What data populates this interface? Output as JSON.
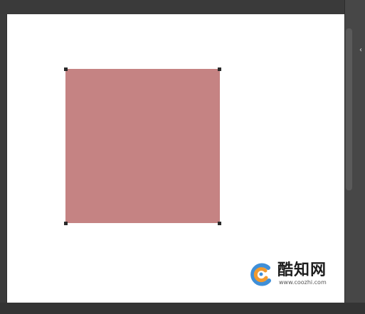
{
  "colors": {
    "shape_fill": "#c58383",
    "canvas": "#ffffff",
    "workspace": "#3b3b3b",
    "handle": "#2a2a2a"
  },
  "canvas": {
    "shape": {
      "type": "rectangle",
      "state": "selected",
      "handles": [
        "top-left",
        "top-right",
        "bottom-left",
        "bottom-right"
      ]
    }
  },
  "side_panel": {
    "collapse_icon": "chevron-left-icon",
    "collapse_glyph": "‹"
  },
  "watermark": {
    "title": "酷知网",
    "url": "www.coozhi.com",
    "logo_icon": "coozhi-logo-icon"
  }
}
